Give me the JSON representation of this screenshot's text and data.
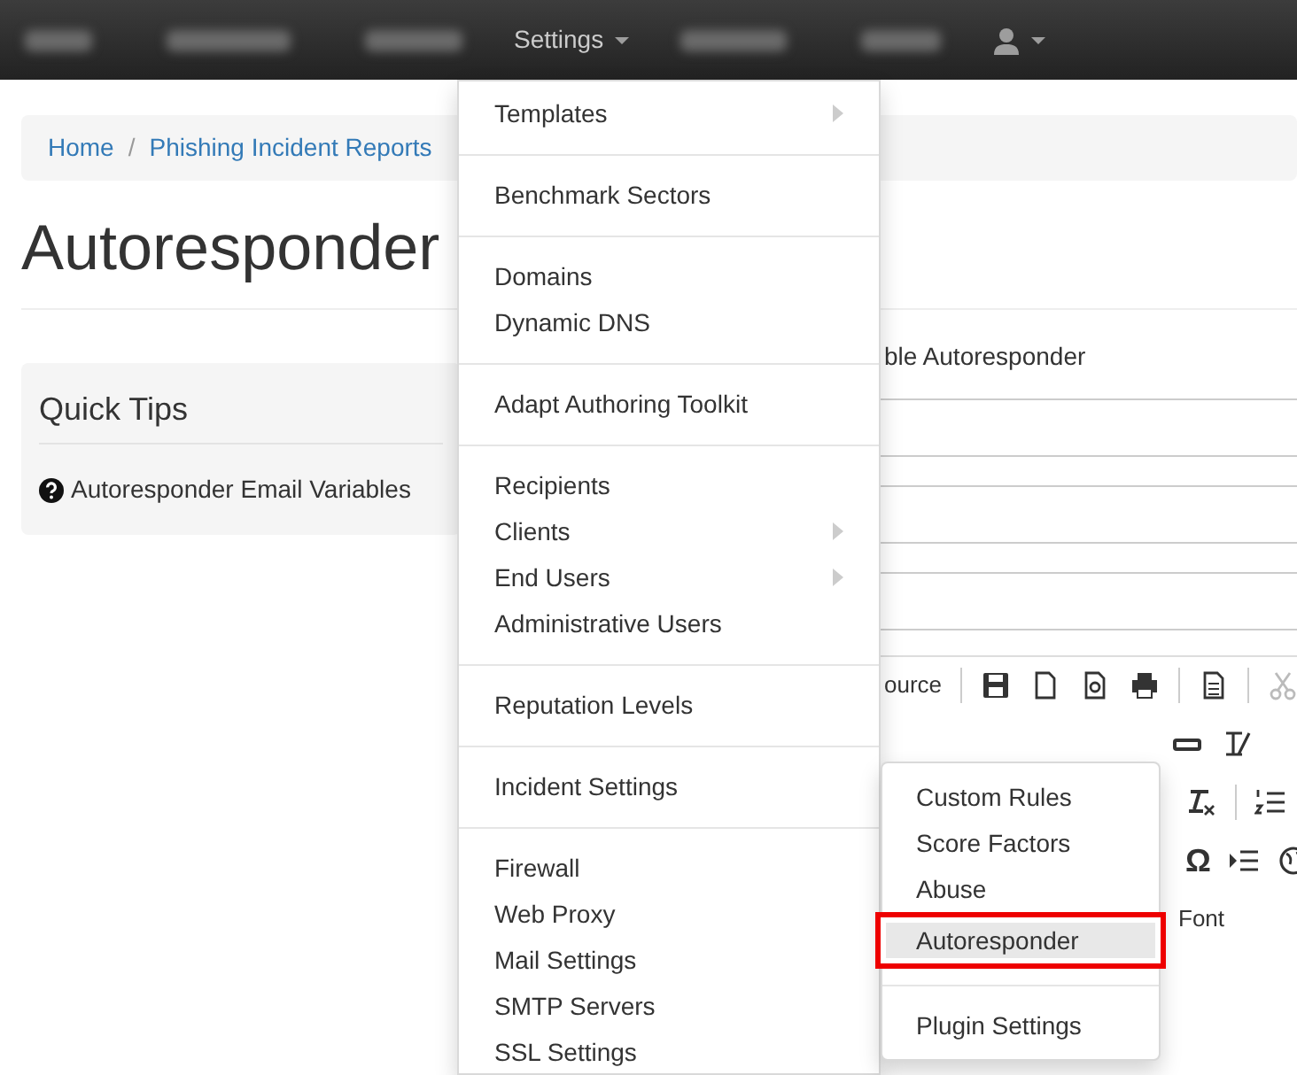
{
  "navbar": {
    "items": [
      {
        "label": "Settings",
        "kind": "dropdown",
        "selected": true
      }
    ]
  },
  "breadcrumb": [
    "Home",
    "Phishing Incident Reports"
  ],
  "breadcrumb_separator": "/",
  "page_title": "Autoresponder",
  "quick_tips": {
    "title": "Quick Tips",
    "items": [
      "Autoresponder Email Variables"
    ]
  },
  "form": {
    "checkbox_label": "ble Autoresponder",
    "editor_source_label": "ource",
    "editor_font_label": "Font",
    "editor_special_char_glyph": "Ω"
  },
  "settings_menu": [
    [
      {
        "label": "Templates",
        "submenu": true
      }
    ],
    [
      {
        "label": "Benchmark Sectors",
        "submenu": false
      }
    ],
    [
      {
        "label": "Domains",
        "submenu": false
      },
      {
        "label": "Dynamic DNS",
        "submenu": false
      }
    ],
    [
      {
        "label": "Adapt Authoring Toolkit",
        "submenu": false
      }
    ],
    [
      {
        "label": "Recipients",
        "submenu": false
      },
      {
        "label": "Clients",
        "submenu": true
      },
      {
        "label": "End Users",
        "submenu": true
      },
      {
        "label": "Administrative Users",
        "submenu": false
      }
    ],
    [
      {
        "label": "Reputation Levels",
        "submenu": false
      }
    ],
    [
      {
        "label": "Incident Settings",
        "submenu": false
      }
    ],
    [
      {
        "label": "Firewall",
        "submenu": false
      },
      {
        "label": "Web Proxy",
        "submenu": false
      },
      {
        "label": "Mail Settings",
        "submenu": false
      },
      {
        "label": "SMTP Servers",
        "submenu": false
      },
      {
        "label": "SSL Settings",
        "submenu": false
      }
    ]
  ],
  "incident_submenu": [
    [
      {
        "label": "Custom Rules",
        "selected": false,
        "highlighted": false
      },
      {
        "label": "Score Factors",
        "selected": false,
        "highlighted": false
      },
      {
        "label": "Abuse",
        "selected": false,
        "highlighted": false
      },
      {
        "label": "Autoresponder",
        "selected": true,
        "highlighted": true
      }
    ],
    [
      {
        "label": "Plugin Settings",
        "selected": false,
        "highlighted": false
      }
    ]
  ]
}
